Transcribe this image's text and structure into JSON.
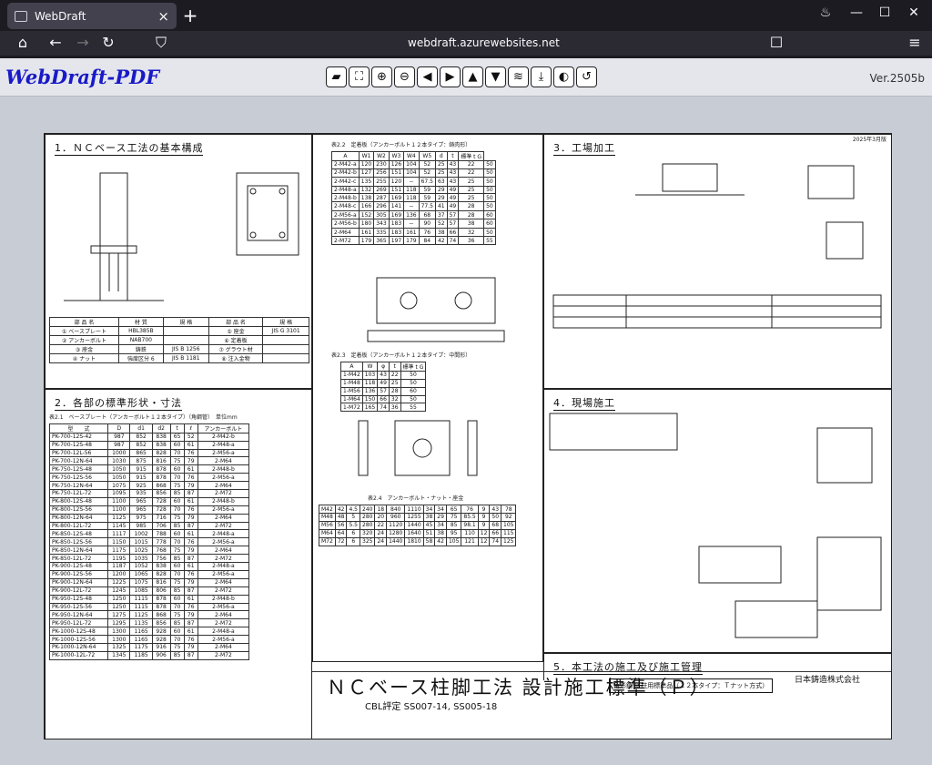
{
  "browser": {
    "tab_title": "WebDraft",
    "url": "webdraft.azurewebsites.net"
  },
  "app": {
    "logo": "WebDraft-PDF",
    "version": "Ver.2505b",
    "toolbar": [
      "folder-icon",
      "fit-icon",
      "zoom-in-icon",
      "zoom-out-icon",
      "arrow-left-icon",
      "arrow-right-icon",
      "arrow-up-icon",
      "arrow-down-icon",
      "layers-icon",
      "download-icon",
      "contrast-icon",
      "rotate-icon"
    ]
  },
  "doc": {
    "date": "2025年3月版",
    "s1": "1．ＮＣベース工法の基本構成",
    "s2": "2．各部の標準形状・寸法",
    "s3": "3．工場加工",
    "s4": "4．現場施工",
    "s5": "5．本工法の施工及び施工管理",
    "t21_caption": "表2.1　ベースプレート（アンカーボルト１２本タイプ）（角鋼管）　単位mm",
    "t21_headers": [
      "型　　式",
      "D",
      "d1",
      "d2",
      "t",
      "ℓ",
      "アンカーボルト"
    ],
    "t21_rows": [
      [
        "PK-700-12S-42",
        "987",
        "852",
        "838",
        "65",
        "52",
        "2-M42-b"
      ],
      [
        "PK-700-12S-48",
        "987",
        "852",
        "838",
        "60",
        "61",
        "2-M48-a"
      ],
      [
        "PK-700-12L-56",
        "1000",
        "865",
        "828",
        "70",
        "76",
        "2-M56-a"
      ],
      [
        "PK-700-12N-64",
        "1030",
        "875",
        "816",
        "75",
        "79",
        "2-M64"
      ],
      [
        "PK-750-12S-48",
        "1050",
        "915",
        "878",
        "60",
        "61",
        "2-M48-b"
      ],
      [
        "PK-750-12S-56",
        "1050",
        "915",
        "878",
        "70",
        "76",
        "2-M56-a"
      ],
      [
        "PK-750-12N-64",
        "1075",
        "925",
        "868",
        "75",
        "79",
        "2-M64"
      ],
      [
        "PK-750-12L-72",
        "1095",
        "935",
        "856",
        "85",
        "87",
        "2-M72"
      ],
      [
        "PK-800-12S-48",
        "1100",
        "965",
        "728",
        "60",
        "61",
        "2-M48-b"
      ],
      [
        "PK-800-12S-56",
        "1100",
        "965",
        "728",
        "70",
        "76",
        "2-M56-a"
      ],
      [
        "PK-800-12N-64",
        "1125",
        "975",
        "716",
        "75",
        "79",
        "2-M64"
      ],
      [
        "PK-800-12L-72",
        "1145",
        "985",
        "706",
        "85",
        "87",
        "2-M72"
      ],
      [
        "PK-850-12S-48",
        "1117",
        "1002",
        "788",
        "60",
        "61",
        "2-M48-a"
      ],
      [
        "PK-850-12S-56",
        "1150",
        "1015",
        "778",
        "70",
        "76",
        "2-M56-a"
      ],
      [
        "PK-850-12N-64",
        "1175",
        "1025",
        "768",
        "75",
        "79",
        "2-M64"
      ],
      [
        "PK-850-12L-72",
        "1195",
        "1035",
        "756",
        "85",
        "87",
        "2-M72"
      ],
      [
        "PK-900-12S-48",
        "1187",
        "1052",
        "838",
        "60",
        "61",
        "2-M48-a"
      ],
      [
        "PK-900-12S-56",
        "1200",
        "1065",
        "828",
        "70",
        "76",
        "2-M56-a"
      ],
      [
        "PK-900-12N-64",
        "1225",
        "1075",
        "816",
        "75",
        "79",
        "2-M64"
      ],
      [
        "PK-900-12L-72",
        "1245",
        "1085",
        "806",
        "85",
        "87",
        "2-M72"
      ],
      [
        "PK-950-12S-48",
        "1250",
        "1115",
        "878",
        "60",
        "61",
        "2-M48-b"
      ],
      [
        "PK-950-12S-56",
        "1250",
        "1115",
        "878",
        "70",
        "76",
        "2-M56-a"
      ],
      [
        "PK-950-12N-64",
        "1275",
        "1125",
        "868",
        "75",
        "79",
        "2-M64"
      ],
      [
        "PK-950-12L-72",
        "1295",
        "1135",
        "856",
        "85",
        "87",
        "2-M72"
      ],
      [
        "PK-1000-12S-48",
        "1300",
        "1165",
        "928",
        "60",
        "61",
        "2-M48-a"
      ],
      [
        "PK-1000-12S-56",
        "1300",
        "1165",
        "928",
        "70",
        "76",
        "2-M56-a"
      ],
      [
        "PK-1000-12N-64",
        "1325",
        "1175",
        "916",
        "75",
        "79",
        "2-M64"
      ],
      [
        "PK-1000-12L-72",
        "1345",
        "1185",
        "906",
        "85",
        "87",
        "2-M72"
      ]
    ],
    "t22_caption": "表2.2　定着板（アンカーボルト１２本タイプ：鋳肉形）",
    "t22_headers": [
      "A",
      "W1",
      "W2",
      "W3",
      "W4",
      "W5",
      "d",
      "t",
      "標準 t G"
    ],
    "t22_rows": [
      [
        "2-M42-a",
        "120",
        "230",
        "126",
        "104",
        "52",
        "25",
        "43",
        "22",
        "50"
      ],
      [
        "2-M42-b",
        "127",
        "256",
        "151",
        "104",
        "52",
        "25",
        "43",
        "22",
        "50"
      ],
      [
        "2-M42-c",
        "135",
        "255",
        "120",
        "－",
        "67.5",
        "63",
        "43",
        "25",
        "50"
      ],
      [
        "2-M48-a",
        "132",
        "269",
        "151",
        "118",
        "59",
        "29",
        "49",
        "25",
        "50"
      ],
      [
        "2-M48-b",
        "138",
        "287",
        "169",
        "118",
        "59",
        "29",
        "49",
        "25",
        "50"
      ],
      [
        "2-M48-c",
        "166",
        "296",
        "141",
        "－",
        "77.5",
        "41",
        "49",
        "28",
        "50"
      ],
      [
        "2-M56-a",
        "152",
        "305",
        "169",
        "136",
        "68",
        "37",
        "57",
        "28",
        "60"
      ],
      [
        "2-M56-b",
        "180",
        "343",
        "183",
        "－",
        "90",
        "52",
        "57",
        "38",
        "60"
      ],
      [
        "2-M64",
        "161",
        "335",
        "183",
        "161",
        "76",
        "38",
        "66",
        "32",
        "50"
      ],
      [
        "2-M72",
        "179",
        "365",
        "197",
        "179",
        "84",
        "42",
        "74",
        "36",
        "55"
      ]
    ],
    "t23_caption": "表2.3　定着板（アンカーボルト１２本タイプ：中間形）",
    "t23_rows": [
      [
        "1-M42",
        "103",
        "43",
        "22",
        "50"
      ],
      [
        "1-M48",
        "118",
        "49",
        "25",
        "50"
      ],
      [
        "1-M56",
        "136",
        "57",
        "28",
        "60"
      ],
      [
        "1-M64",
        "150",
        "66",
        "32",
        "50"
      ],
      [
        "1-M72",
        "165",
        "74",
        "36",
        "55"
      ]
    ],
    "t24_caption": "表2.4　アンカーボルト・ナット・座金",
    "t24_rows": [
      [
        "M42",
        "42",
        "4.5",
        "240",
        "18",
        "840",
        "1110",
        "34",
        "34",
        "65",
        "76",
        "9",
        "43",
        "78"
      ],
      [
        "M48",
        "48",
        "5",
        "280",
        "20",
        "960",
        "1255",
        "38",
        "29",
        "75",
        "85.5",
        "9",
        "50",
        "92"
      ],
      [
        "M56",
        "56",
        "5.5",
        "280",
        "22",
        "1120",
        "1440",
        "45",
        "34",
        "85",
        "98.1",
        "9",
        "68",
        "105"
      ],
      [
        "M64",
        "64",
        "6",
        "320",
        "24",
        "1280",
        "1640",
        "51",
        "38",
        "95",
        "110",
        "12",
        "66",
        "115"
      ],
      [
        "M72",
        "72",
        "6",
        "325",
        "24",
        "1440",
        "1810",
        "58",
        "42",
        "105",
        "121",
        "12",
        "74",
        "125"
      ]
    ],
    "title": "ＮＣベース柱脚工法 設計施工標準（Ｐ）",
    "subtitle": "CBL評定 SS007-14, SS005-18",
    "docbox": "角形鋼管 柱用標準品（１２本タイプ：Ｔナット方式）",
    "company": "日本鋳造株式会社"
  }
}
